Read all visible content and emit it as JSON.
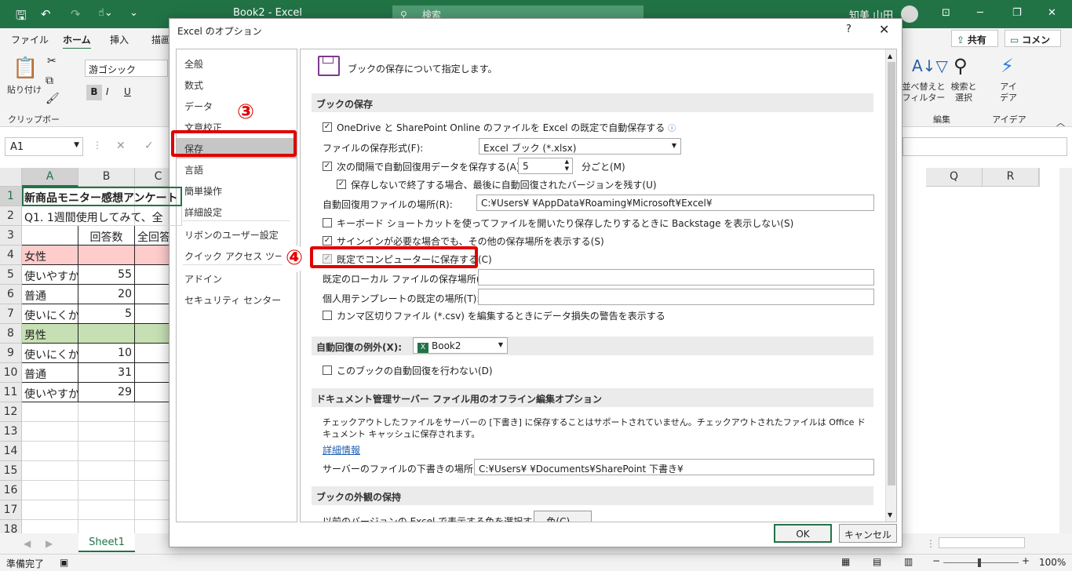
{
  "window": {
    "title": "Book2  -  Excel",
    "search_placeholder": "検索",
    "user_name": "知美 山田"
  },
  "menu": {
    "tabs": [
      "ファイル",
      "ホーム",
      "挿入",
      "描画"
    ],
    "share_label": "共有",
    "comment_label": "コメント"
  },
  "ribbon": {
    "paste_label": "貼り付け",
    "clipboard_group": "クリップボード",
    "font_name": "游ゴシック",
    "sort_filter_label": "並べ替えと\nフィルター",
    "find_select_label": "検索と\n選択",
    "edit_group": "編集",
    "ideas_label": "アイ\nデア",
    "ideas_group": "アイデア"
  },
  "formula_bar": {
    "name_box": "A1"
  },
  "sheet": {
    "columns_left": [
      "A",
      "B",
      "C"
    ],
    "columns_right": [
      "Q",
      "R"
    ],
    "rows": [
      {
        "num": "1",
        "a": "新商品モニター感想アンケート",
        "b": "",
        "c": "",
        "style": "title"
      },
      {
        "num": "2",
        "a": "Q1. 1週間使用してみて、全",
        "b": "",
        "c": "",
        "style": "plain"
      },
      {
        "num": "3",
        "a": "",
        "b": "回答数",
        "c": "全回答",
        "style": "header"
      },
      {
        "num": "4",
        "a": "女性",
        "b": "",
        "c": "",
        "style": "female"
      },
      {
        "num": "5",
        "a": "使いやすか",
        "b": "55",
        "c": "",
        "style": "data"
      },
      {
        "num": "6",
        "a": "普通",
        "b": "20",
        "c": "",
        "style": "data"
      },
      {
        "num": "7",
        "a": "使いにくか",
        "b": "5",
        "c": "",
        "style": "data"
      },
      {
        "num": "8",
        "a": "男性",
        "b": "",
        "c": "",
        "style": "male"
      },
      {
        "num": "9",
        "a": "使いにくか",
        "b": "10",
        "c": "",
        "style": "data"
      },
      {
        "num": "10",
        "a": "普通",
        "b": "31",
        "c": "",
        "style": "data"
      },
      {
        "num": "11",
        "a": "使いやすか",
        "b": "29",
        "c": "",
        "style": "data"
      },
      {
        "num": "12",
        "a": "",
        "b": "",
        "c": "",
        "style": "empty"
      },
      {
        "num": "13",
        "a": "",
        "b": "",
        "c": "",
        "style": "empty"
      },
      {
        "num": "14",
        "a": "",
        "b": "",
        "c": "",
        "style": "empty"
      },
      {
        "num": "15",
        "a": "",
        "b": "",
        "c": "",
        "style": "empty"
      },
      {
        "num": "16",
        "a": "",
        "b": "",
        "c": "",
        "style": "empty"
      },
      {
        "num": "17",
        "a": "",
        "b": "",
        "c": "",
        "style": "empty"
      },
      {
        "num": "18",
        "a": "",
        "b": "",
        "c": "",
        "style": "empty"
      }
    ],
    "tab_name": "Sheet1",
    "status": "準備完了",
    "zoom": "100%"
  },
  "dialog": {
    "title": "Excel のオプション",
    "help": "?",
    "nav": [
      "全般",
      "数式",
      "データ",
      "文章校正",
      "保存",
      "言語",
      "簡単操作",
      "詳細設定",
      "リボンのユーザー設定",
      "クイック アクセス ツール バー",
      "アドイン",
      "セキュリティ センター"
    ],
    "selected_nav": "保存",
    "header_text": "ブックの保存について指定します。",
    "sections": {
      "save_books": "ブックの保存",
      "autorecover_exceptions": "自動回復の例外(X):",
      "offline_editing": "ドキュメント管理サーバー ファイル用のオフライン編集オプション",
      "preserve_visual": "ブックの外観の保持"
    },
    "options": {
      "onedrive_autosave": "OneDrive と SharePoint Online のファイルを Excel の既定で自動保存する",
      "file_format_label": "ファイルの保存形式(F):",
      "file_format_value": "Excel ブック (*.xlsx)",
      "autorecover_interval_label": "次の間隔で自動回復用データを保存する(A):",
      "autorecover_interval_value": "5",
      "autorecover_interval_unit": "分ごと(M)",
      "keep_last_version": "保存しないで終了する場合、最後に自動回復されたバージョンを残す(U)",
      "autorecover_location_label": "自動回復用ファイルの場所(R):",
      "autorecover_location_value": "C:¥Users¥         ¥AppData¥Roaming¥Microsoft¥Excel¥",
      "no_backstage": "キーボード ショートカットを使ってファイルを開いたり保存したりするときに Backstage を表示しない(S)",
      "show_extra_locations": "サインインが必要な場合でも、その他の保存場所を表示する(S)",
      "save_to_computer": "既定でコンピューターに保存する(C)",
      "default_local_label": "既定のローカル ファイルの保存場所(I):",
      "default_local_value": "",
      "template_label": "個人用テンプレートの既定の場所(T):",
      "template_value": "",
      "csv_warning": "カンマ区切りファイル (*.csv) を編集するときにデータ損失の警告を表示する",
      "exception_book": "Book2",
      "disable_autorecover": "このブックの自動回復を行わない(D)",
      "offline_note": "チェックアウトしたファイルをサーバーの [下書き] に保存することはサポートされていません。チェックアウトされたファイルは Office ドキュメント キャッシュに保存されます。",
      "details_link": "詳細情報",
      "server_drafts_label": "サーバーのファイルの下書きの場所(V):",
      "server_drafts_value": "C:¥Users¥         ¥Documents¥SharePoint 下書き¥",
      "colors_label": "以前のバージョンの Excel で表示する色を選択する:",
      "colors_button": "色(C)..."
    },
    "ok": "OK",
    "cancel": "キャンセル"
  },
  "annotations": {
    "step3": "③",
    "step4": "④"
  },
  "colors": {
    "excel_green": "#217346",
    "annotation_red": "#e00000",
    "female_fill": "#ffcccc",
    "male_fill": "#c6e0b4"
  }
}
